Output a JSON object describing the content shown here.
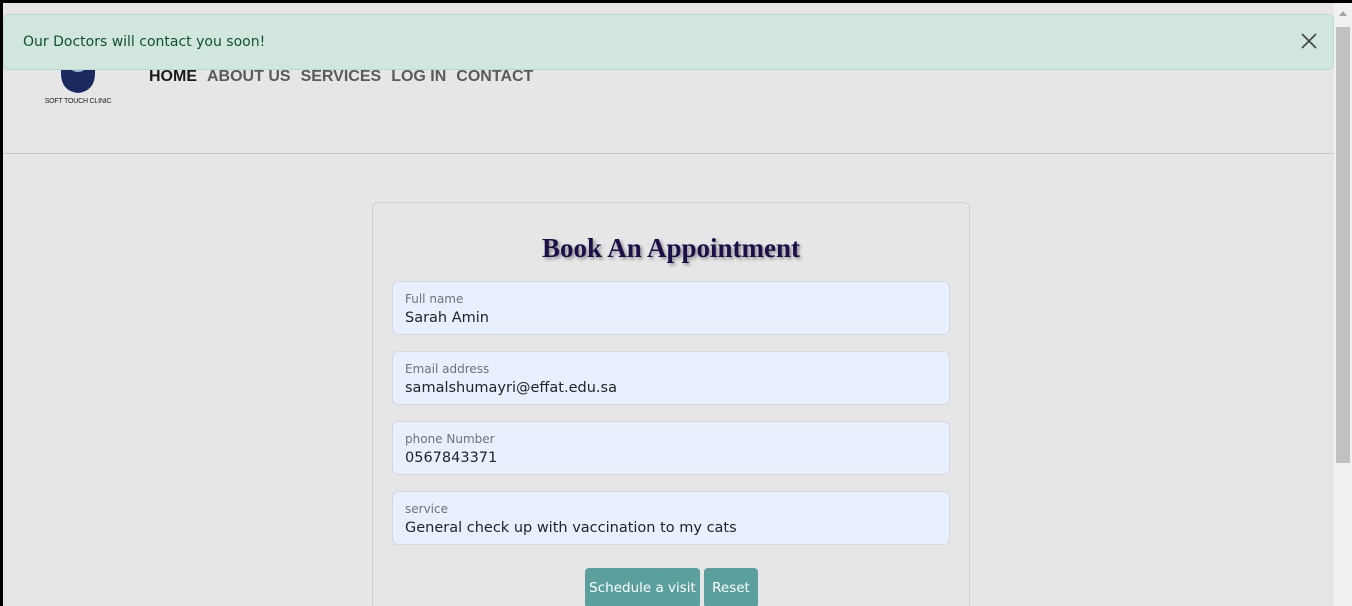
{
  "alert": {
    "message": "Our Doctors will contact you soon!"
  },
  "brand": {
    "logo_caption": "SOFT TOUCH CLINIC"
  },
  "nav": {
    "items": [
      {
        "label": "HOME"
      },
      {
        "label": "ABOUT US"
      },
      {
        "label": "SERVICES"
      },
      {
        "label": "LOG IN"
      },
      {
        "label": "CONTACT"
      }
    ],
    "active": "HOME"
  },
  "form": {
    "title": "Book An Appointment",
    "fields": [
      {
        "label": "Full name",
        "value": "Sarah Amin"
      },
      {
        "label": "Email address",
        "value": "samalshumayri@effat.edu.sa"
      },
      {
        "label": "phone Number",
        "value": "0567843371"
      },
      {
        "label": "service",
        "value": "General check up with vaccination to my cats"
      }
    ],
    "submit_label": "Schedule a visit",
    "reset_label": "Reset"
  },
  "colors": {
    "accent": "#5b9f9f",
    "title": "#1e0f4a",
    "alert_bg": "#d1e7dd",
    "alert_text": "#0f5132",
    "field_bg": "#e8f0fe",
    "page_bg": "#e6e6e6"
  },
  "icons": {
    "logo": "cat-paw-logo",
    "alert_close": "close-icon",
    "scroll_up": "chevron-up-icon"
  }
}
